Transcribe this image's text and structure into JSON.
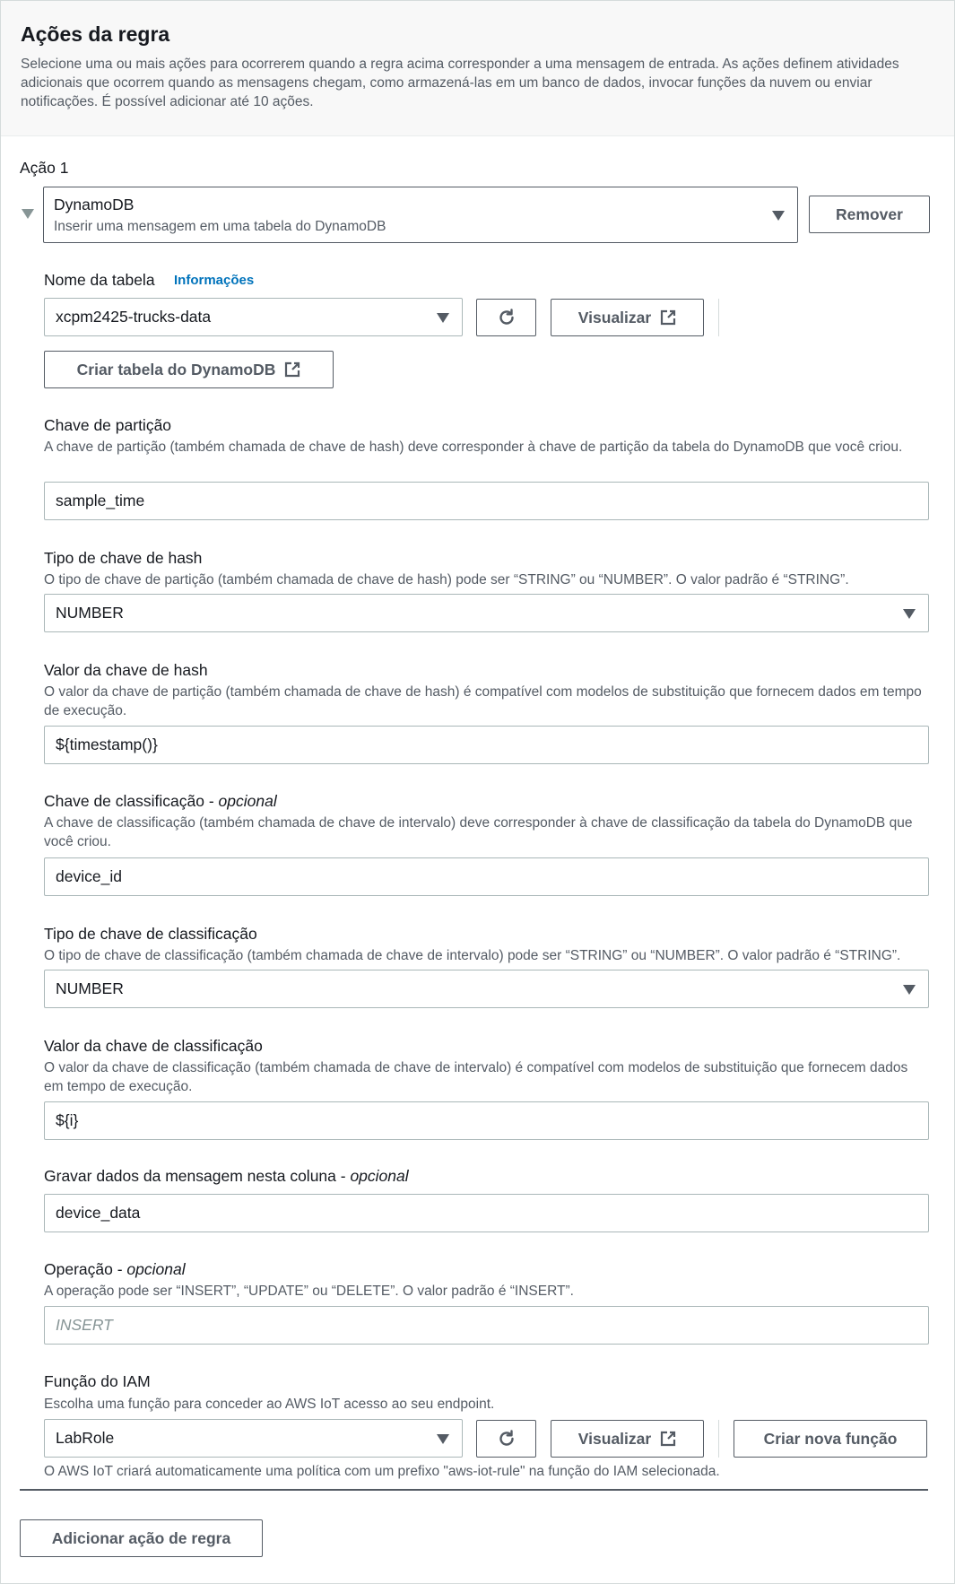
{
  "header": {
    "title": "Ações da regra",
    "description": "Selecione uma ou mais ações para ocorrerem quando a regra acima corresponder a uma mensagem de entrada. As ações definem atividades adicionais que ocorrem quando as mensagens chegam, como armazená-las em um banco de dados, invocar funções da nuvem ou enviar notificações. É possível adicionar até 10 ações."
  },
  "action": {
    "label": "Ação 1",
    "service": "DynamoDB",
    "service_description": "Inserir uma mensagem em uma tabela do DynamoDB",
    "remove_label": "Remover"
  },
  "table": {
    "label": "Nome da tabela",
    "info_link": "Informações",
    "value": "xcpm2425-trucks-data",
    "view_label": "Visualizar",
    "create_label": "Criar tabela do DynamoDB"
  },
  "partition_key": {
    "label": "Chave de partição",
    "description": "A chave de partição (também chamada de chave de hash) deve corresponder à chave de partição da tabela do DynamoDB que você criou.",
    "value": "sample_time"
  },
  "hash_key_type": {
    "label": "Tipo de chave de hash",
    "description": "O tipo de chave de partição (também chamada de chave de hash) pode ser “STRING” ou “NUMBER”. O valor padrão é “STRING”.",
    "value": "NUMBER"
  },
  "hash_key_value": {
    "label": "Valor da chave de hash",
    "description": "O valor da chave de partição (também chamada de chave de hash) é compatível com modelos de substituição que fornecem dados em tempo de execução.",
    "value": "${timestamp()}"
  },
  "sort_key": {
    "label": "Chave de classificação - ",
    "label_optional": "opcional",
    "description": "A chave de classificação (também chamada de chave de intervalo) deve corresponder à chave de classificação da tabela do DynamoDB que você criou.",
    "value": "device_id"
  },
  "sort_key_type": {
    "label": "Tipo de chave de classificação",
    "description": "O tipo de chave de classificação (também chamada de chave de intervalo) pode ser “STRING” ou “NUMBER”. O valor padrão é “STRING”.",
    "value": "NUMBER"
  },
  "sort_key_value": {
    "label": "Valor da chave de classificação",
    "description": "O valor da chave de classificação (também chamada de chave de intervalo) é compatível com modelos de substituição que fornecem dados em tempo de execução.",
    "value": "${i}"
  },
  "message_column": {
    "label": "Gravar dados da mensagem nesta coluna - ",
    "label_optional": "opcional",
    "value": "device_data"
  },
  "operation": {
    "label": "Operação - ",
    "label_optional": "opcional",
    "description": "A operação pode ser “INSERT”, “UPDATE” ou “DELETE”. O valor padrão é “INSERT”.",
    "placeholder": "INSERT"
  },
  "iam_role": {
    "label": "Função do IAM",
    "description": "Escolha uma função para conceder ao AWS IoT acesso ao seu endpoint.",
    "value": "LabRole",
    "view_label": "Visualizar",
    "create_label": "Criar nova função",
    "note": "O AWS IoT criará automaticamente uma política com um prefixo \"aws-iot-rule\" na função do IAM selecionada."
  },
  "footer": {
    "add_label": "Adicionar ação de regra"
  }
}
